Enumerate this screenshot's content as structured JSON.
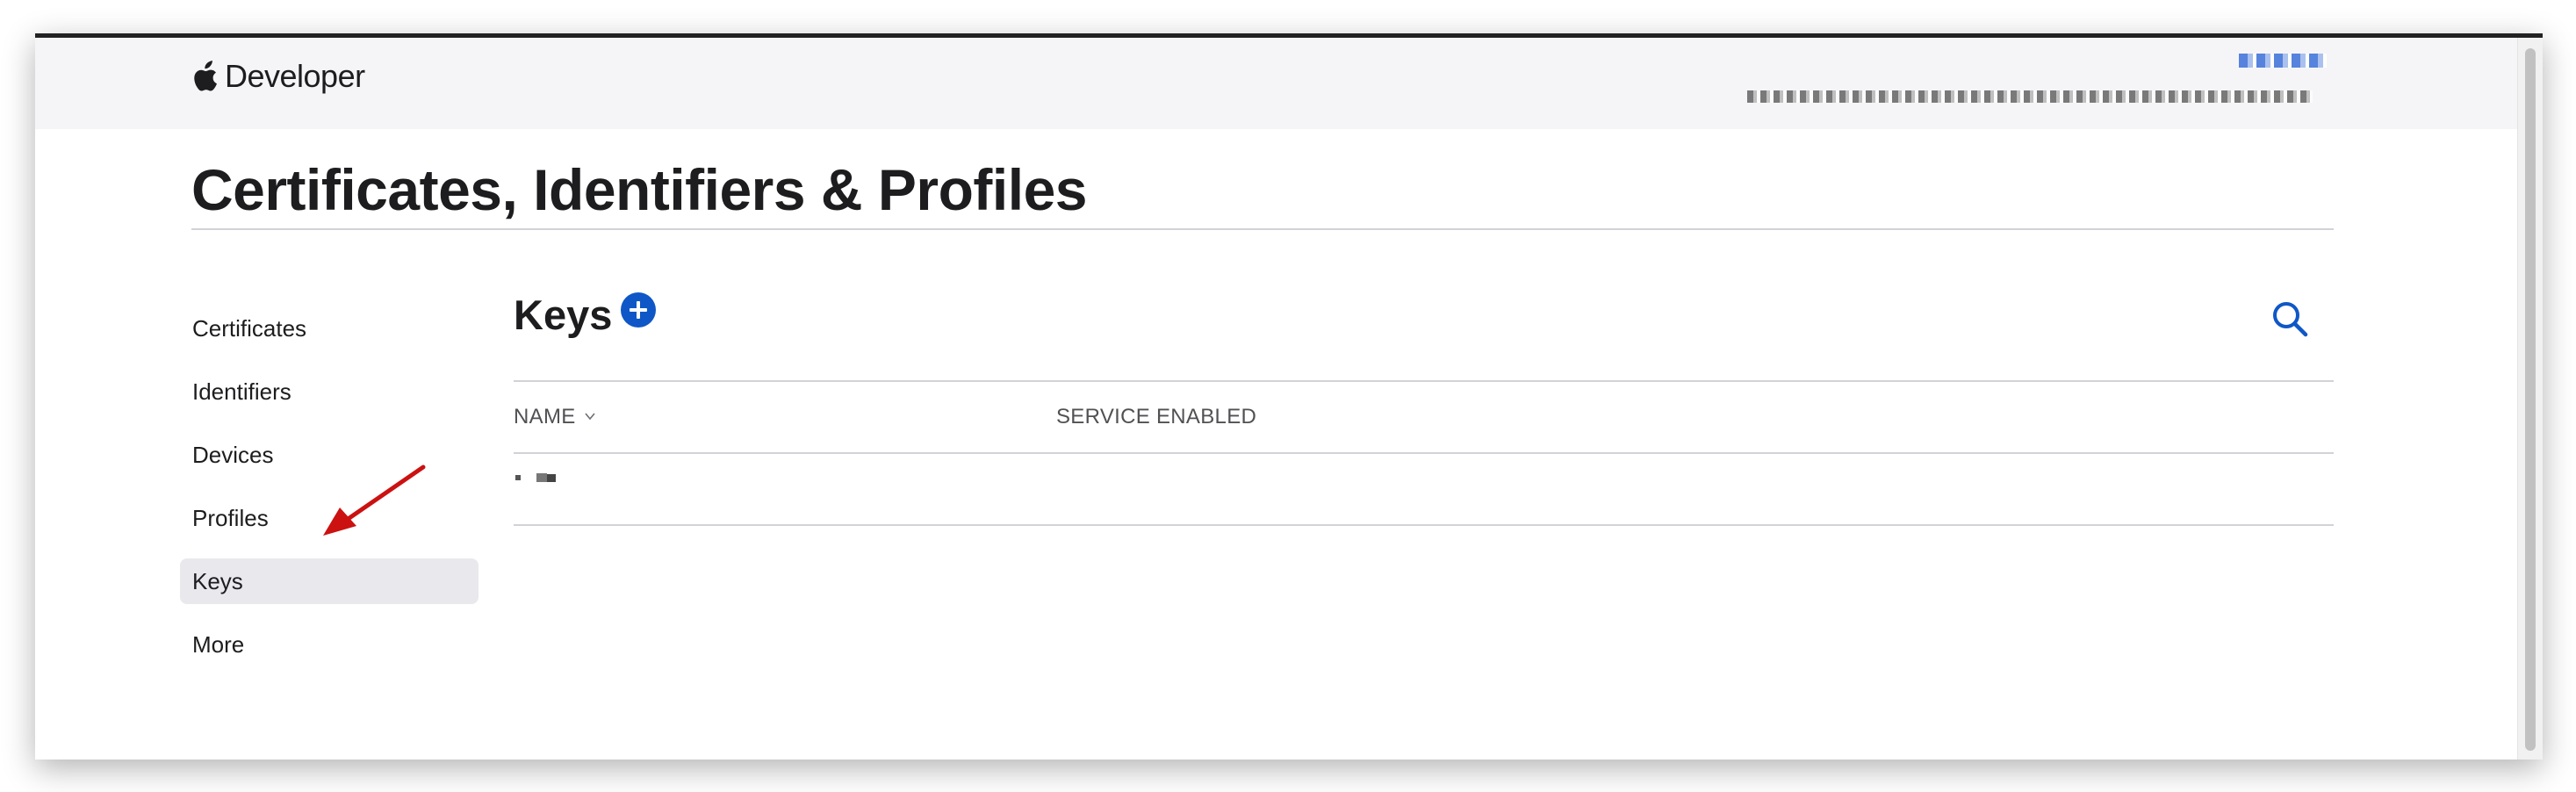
{
  "header": {
    "brand": "Developer",
    "account_name": "",
    "account_team": ""
  },
  "page": {
    "title": "Certificates, Identifiers & Profiles"
  },
  "sidebar": {
    "items": [
      {
        "label": "Certificates",
        "active": false
      },
      {
        "label": "Identifiers",
        "active": false
      },
      {
        "label": "Devices",
        "active": false
      },
      {
        "label": "Profiles",
        "active": false
      },
      {
        "label": "Keys",
        "active": true
      },
      {
        "label": "More",
        "active": false
      }
    ]
  },
  "main": {
    "section_title": "Keys",
    "add_icon": "plus-circle-icon",
    "search_icon": "search-icon",
    "columns": [
      {
        "label": "NAME",
        "sortable": true
      },
      {
        "label": "SERVICE ENABLED",
        "sortable": false
      }
    ],
    "rows": [
      {
        "name": "",
        "service_enabled": ""
      }
    ]
  },
  "colors": {
    "accent": "#0f57c7",
    "active_item_bg": "#e8e8ed",
    "header_bg": "#f5f5f7",
    "annotation_arrow": "#cc1111"
  }
}
